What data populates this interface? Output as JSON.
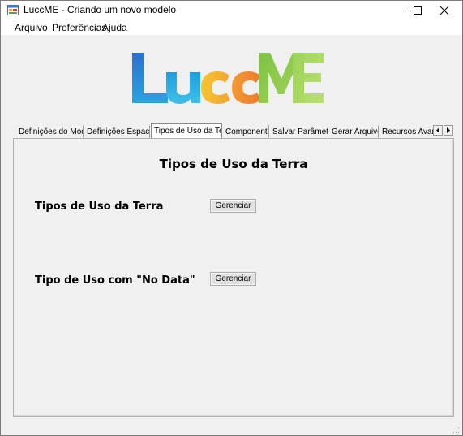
{
  "window": {
    "title": "LuccME - Criando um novo modelo",
    "app_icon": "window-app-icon",
    "controls": {
      "minimize": "minimize-icon",
      "maximize": "maximize-icon",
      "close": "close-icon"
    }
  },
  "menubar": {
    "items": [
      {
        "label": "Arquivo"
      },
      {
        "label": "Preferências"
      },
      {
        "label": "Ajuda"
      }
    ]
  },
  "logo": {
    "text": "LuccME",
    "colors": {
      "l": "#2a7fd4",
      "u": "#1fa8e0",
      "c1": "#f2c02a",
      "c2": "#f08a30",
      "m": "#8cc63f",
      "e": "#a6d85a"
    }
  },
  "tabs": {
    "items": [
      {
        "label": "Definições do Modelo"
      },
      {
        "label": "Definições Espaciais"
      },
      {
        "label": "Tipos de Uso da Terra"
      },
      {
        "label": "Componentes"
      },
      {
        "label": "Salvar Parâmetros"
      },
      {
        "label": "Gerar Arquivos"
      },
      {
        "label": "Recursos Avança"
      }
    ],
    "active_index": 2,
    "scroll_left": "scroll-left-icon",
    "scroll_right": "scroll-right-icon"
  },
  "page": {
    "title": "Tipos de Uso da Terra",
    "rows": [
      {
        "label": "Tipos de Uso da Terra",
        "button": "Gerenciar"
      },
      {
        "label": "Tipo de Uso com \"No Data\"",
        "button": "Gerenciar"
      }
    ]
  }
}
